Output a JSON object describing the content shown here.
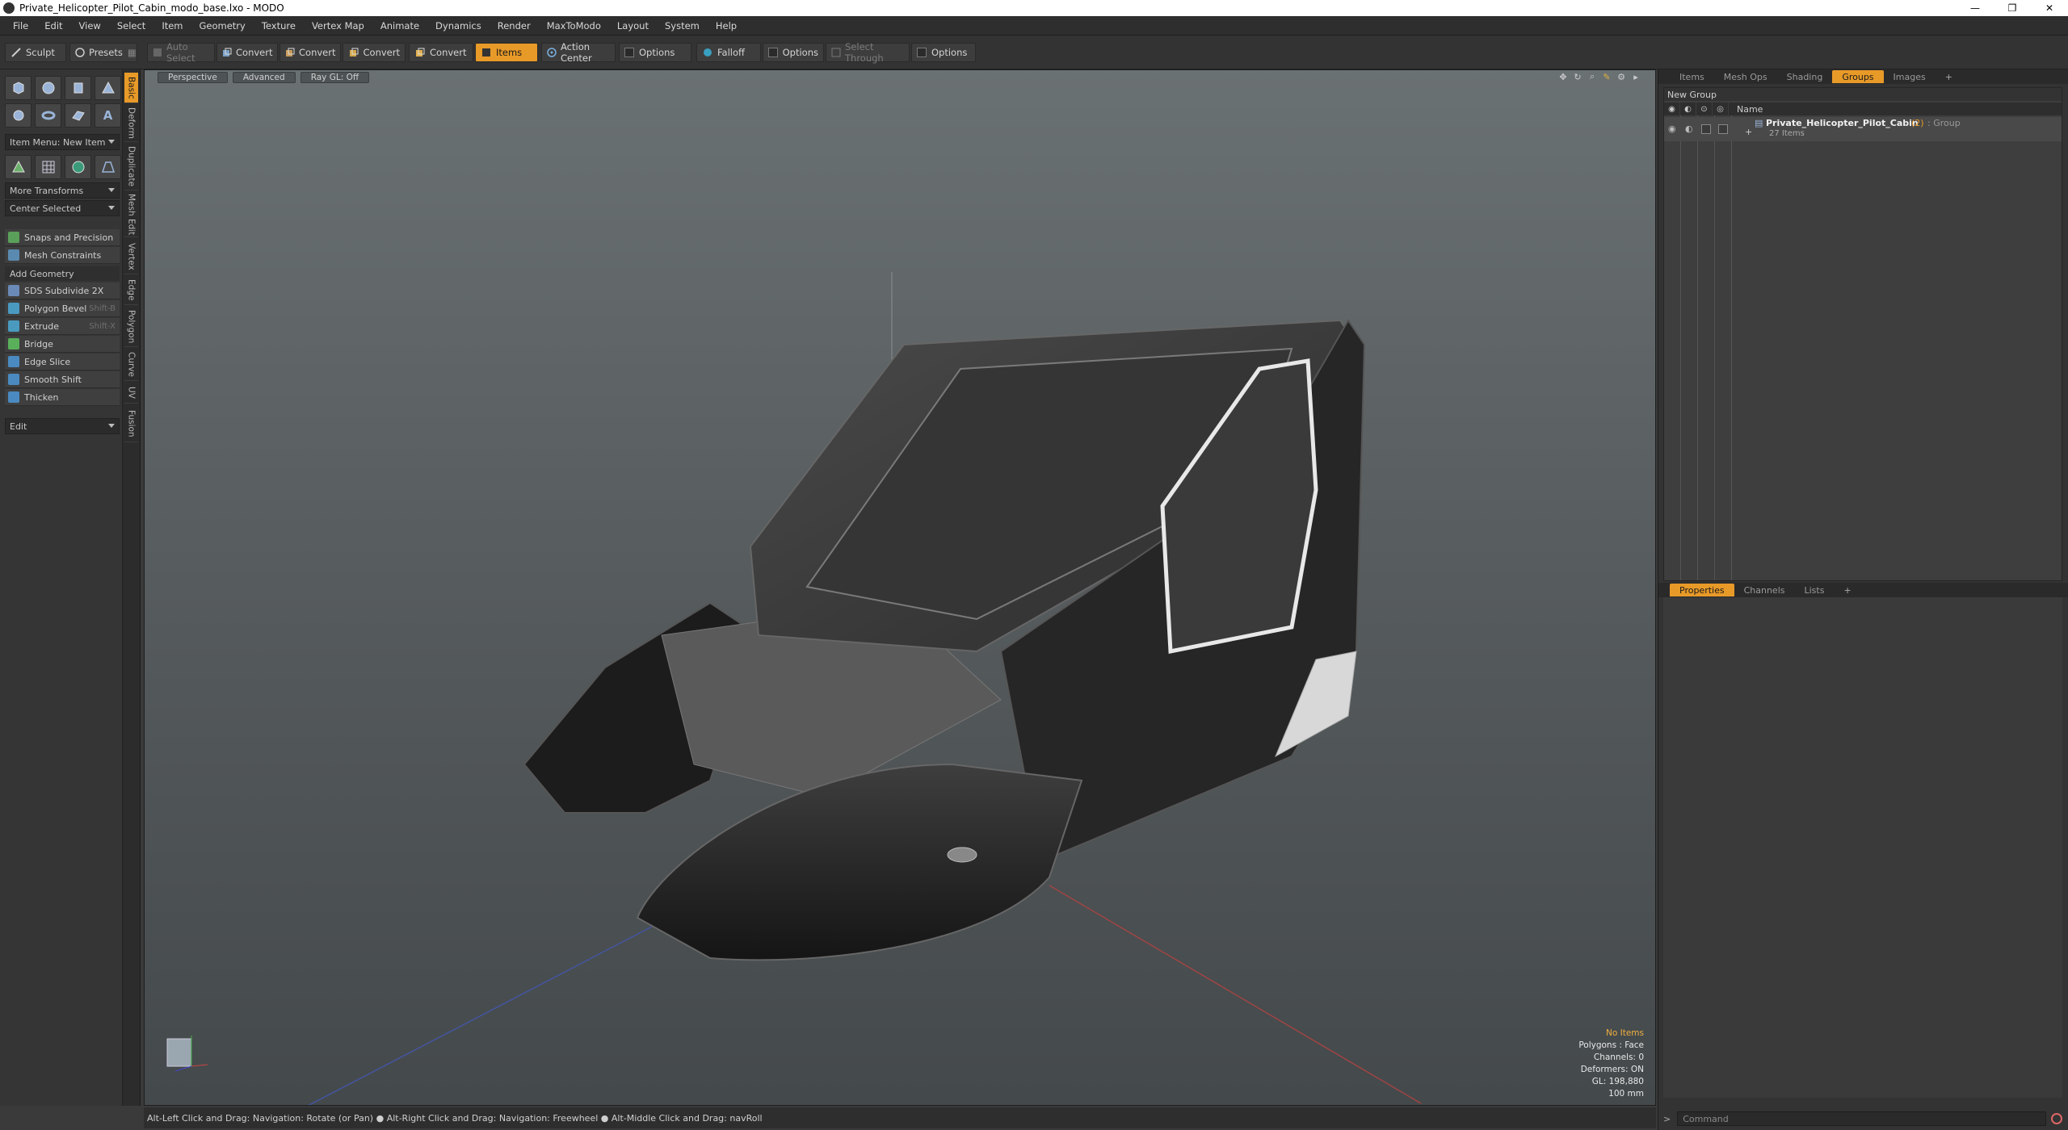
{
  "window": {
    "title": "Private_Helicopter_Pilot_Cabin_modo_base.lxo - MODO",
    "minimize": "—",
    "restore": "❐",
    "close": "✕"
  },
  "menu": [
    "File",
    "Edit",
    "View",
    "Select",
    "Item",
    "Geometry",
    "Texture",
    "Vertex Map",
    "Animate",
    "Dynamics",
    "Render",
    "MaxToModo",
    "Layout",
    "System",
    "Help"
  ],
  "toolbar": {
    "sculpt": "Sculpt",
    "presets": "Presets",
    "auto_select": "Auto Select",
    "convert1": "Convert",
    "convert2": "Convert",
    "convert3": "Convert",
    "convert4": "Convert",
    "items": "Items",
    "action_center": "Action Center",
    "options1": "Options",
    "falloff": "Falloff",
    "options2": "Options",
    "select_through": "Select Through",
    "options3": "Options"
  },
  "left": {
    "item_menu": "Item Menu: New Item",
    "more_transforms": "More Transforms",
    "center_selected": "Center Selected",
    "snaps": "Snaps and Precision",
    "mesh_constraints": "Mesh Constraints",
    "add_geometry": "Add Geometry",
    "tools": [
      {
        "label": "SDS Subdivide 2X",
        "shortcut": ""
      },
      {
        "label": "Polygon Bevel",
        "shortcut": "Shift-B"
      },
      {
        "label": "Extrude",
        "shortcut": "Shift-X"
      },
      {
        "label": "Bridge",
        "shortcut": ""
      },
      {
        "label": "Edge Slice",
        "shortcut": ""
      },
      {
        "label": "Smooth Shift",
        "shortcut": ""
      },
      {
        "label": "Thicken",
        "shortcut": ""
      }
    ],
    "edit": "Edit"
  },
  "vtabs": [
    "Basic",
    "Deform",
    "Duplicate",
    "Mesh Edit",
    "Vertex",
    "Edge",
    "Polygon",
    "Curve",
    "UV",
    "Fusion"
  ],
  "viewport": {
    "view": "Perspective",
    "mode": "Advanced",
    "raygl": "Ray GL: Off",
    "stats": {
      "items": "No Items",
      "polygons": "Polygons : Face",
      "channels": "Channels: 0",
      "deformers": "Deformers: ON",
      "gl": "GL: 198,880",
      "scale": "100 mm"
    }
  },
  "status": "Alt-Left Click and Drag: Navigation: Rotate (or Pan) ● Alt-Right Click and Drag: Navigation: Freewheel ● Alt-Middle Click and Drag: navRoll",
  "right": {
    "top_tabs": [
      "Items",
      "Mesh Ops",
      "Shading",
      "Groups",
      "Images",
      "+"
    ],
    "new_group": "New Group",
    "col_name": "Name",
    "group_name": "Private_Helicopter_Pilot_Cabin",
    "group_count": "(2)",
    "group_type": ": Group",
    "group_items": "27 Items",
    "bottom_tabs": [
      "Properties",
      "Channels",
      "Lists",
      "+"
    ],
    "command_placeholder": "Command",
    "prompt": ">"
  },
  "colors": {
    "accent": "#e89a28",
    "panel": "#353535",
    "viewport_top": "#6a7173",
    "viewport_bottom": "#44494b"
  }
}
